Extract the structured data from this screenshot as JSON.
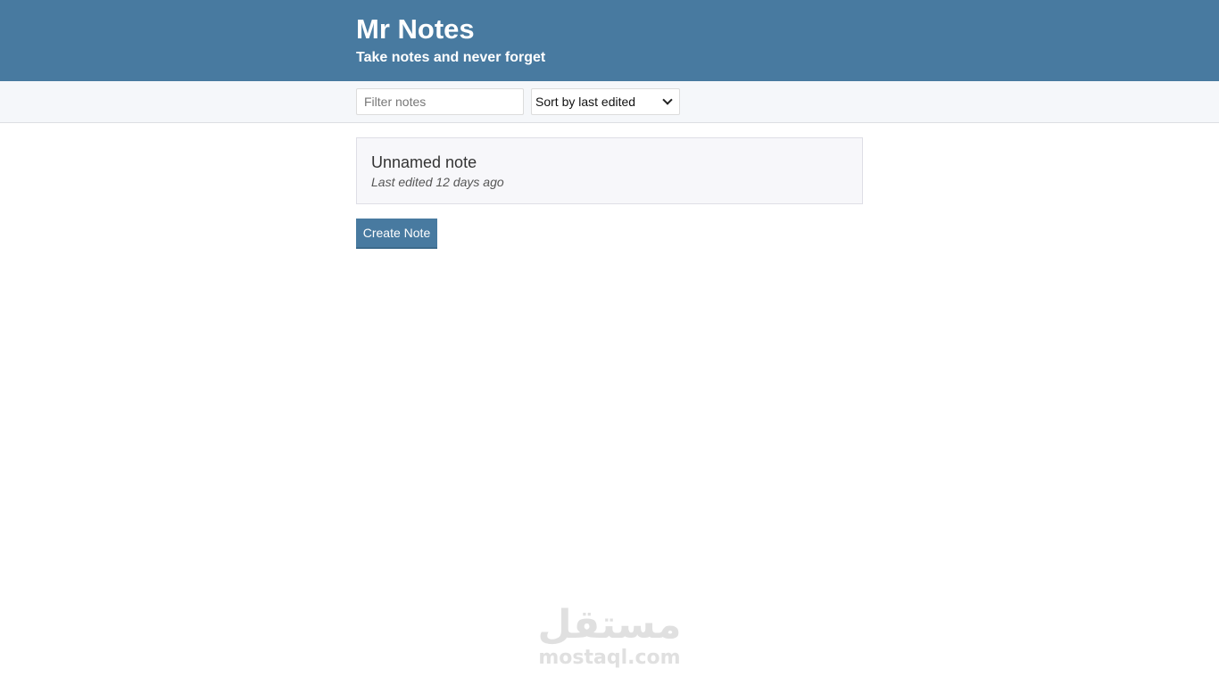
{
  "header": {
    "title": "Mr Notes",
    "subtitle": "Take notes and never forget"
  },
  "actions": {
    "filter": {
      "value": "",
      "placeholder": "Filter notes"
    },
    "sort": {
      "selected": "Sort by last edited"
    }
  },
  "notes": [
    {
      "title": "Unnamed note",
      "subtitle": "Last edited 12 days ago"
    }
  ],
  "create_button": {
    "label": "Create Note"
  },
  "watermark": {
    "arabic": "مستقل",
    "latin": "mostaql.com"
  },
  "colors": {
    "brand": "#487aa0",
    "actions_bar": "#f5f7fa",
    "note_background": "#f7f7fa"
  }
}
